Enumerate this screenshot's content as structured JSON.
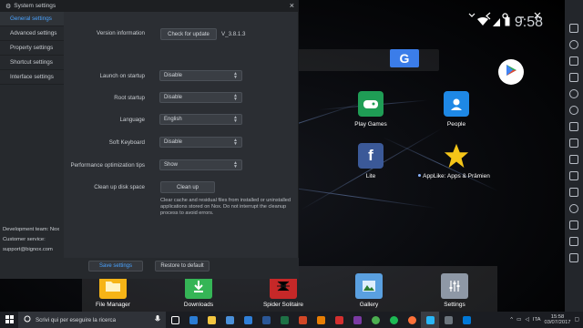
{
  "dialog": {
    "title": "System settings",
    "nav": [
      {
        "label": "General settings",
        "active": true
      },
      {
        "label": "Advanced settings",
        "active": false
      },
      {
        "label": "Property settings",
        "active": false
      },
      {
        "label": "Shortcut settings",
        "active": false
      },
      {
        "label": "Interface settings",
        "active": false
      }
    ],
    "contact": {
      "team": "Development team: Nox",
      "service": "Customer service:",
      "email": "support@bignox.com"
    },
    "version": {
      "label": "Version information",
      "button": "Check for update",
      "value": "V_3.8.1.3"
    },
    "fields": [
      {
        "label": "Launch on startup",
        "value": "Disable"
      },
      {
        "label": "Root startup",
        "value": "Disable"
      },
      {
        "label": "Language",
        "value": "English"
      },
      {
        "label": "Soft Keyboard",
        "value": "Disable"
      },
      {
        "label": "Performance optimization tips",
        "value": "Show"
      }
    ],
    "cleanup": {
      "label": "Clean up disk space",
      "button": "Clean up",
      "description": "Clear cache and residual files from installed or uninstalled applications stored on Nox. Do not interrupt the cleanup process to avoid errors."
    },
    "save_button": "Save settings",
    "restore_button": "Restore to default",
    "accent_color": "#4aa3ff"
  },
  "android": {
    "clock": "9:58",
    "search_button": "G",
    "apps": [
      {
        "label": "Play Games",
        "icon": "play-games-icon",
        "color": "#1f9d55"
      },
      {
        "label": "People",
        "icon": "people-icon",
        "color": "#1e88e5"
      },
      {
        "label": "Lite",
        "icon": "facebook-icon",
        "color": "#3b5998"
      },
      {
        "label": "AppLike: Apps & Prämien",
        "icon": "applike-star-icon",
        "color": "#f5c518"
      }
    ],
    "dock": [
      {
        "label": "File Manager",
        "icon": "folder-icon",
        "color": "#f6b417"
      },
      {
        "label": "Downloads",
        "icon": "download-icon",
        "color": "#35b556"
      },
      {
        "label": "Spider Solitaire",
        "icon": "spider-icon",
        "color": "#c62828"
      },
      {
        "label": "Gallery",
        "icon": "gallery-icon",
        "color": "#5aa0e0"
      },
      {
        "label": "Settings",
        "icon": "settings-sliders-icon",
        "color": "#8e98a6"
      }
    ]
  },
  "taskbar": {
    "search_placeholder": "Scrivi qui per eseguire la ricerca",
    "language": "ITA",
    "time": "15:58",
    "date": "03/07/2017"
  }
}
